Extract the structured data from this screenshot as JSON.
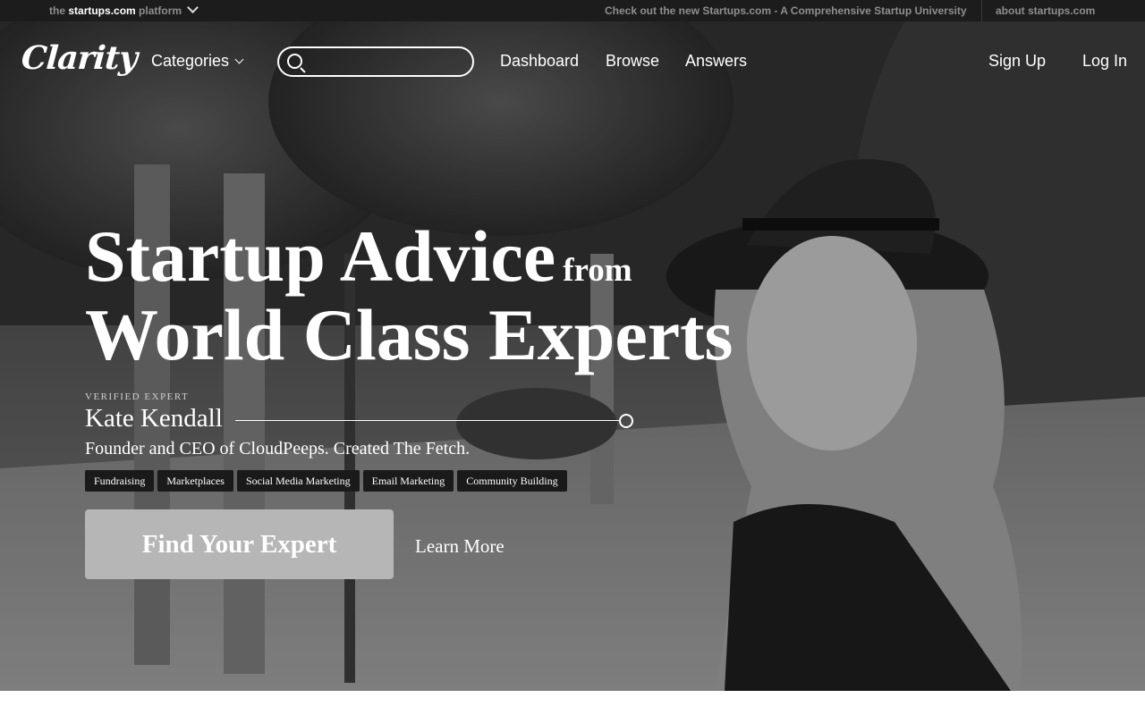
{
  "platform_bar": {
    "prefix": "the ",
    "brand": "startups.com",
    "suffix": " platform",
    "promo": "Check out the new Startups.com - A Comprehensive Startup University",
    "about": "about startups.com"
  },
  "nav": {
    "logo": "Clarity",
    "categories": "Categories",
    "search_placeholder": "",
    "links": [
      "Dashboard",
      "Browse",
      "Answers"
    ],
    "signup": "Sign Up",
    "login": "Log In"
  },
  "hero": {
    "headline_main": "Startup Advice",
    "headline_small": "from",
    "headline_line2": "World Class Experts",
    "verified_label": "VERIFIED EXPERT",
    "expert_name": "Kate Kendall",
    "expert_title": "Founder and CEO of CloudPeeps. Created The Fetch.",
    "tags": [
      "Fundraising",
      "Marketplaces",
      "Social Media Marketing",
      "Email Marketing",
      "Community Building"
    ],
    "cta": "Find Your Expert",
    "learn_more": "Learn More"
  },
  "colors": {
    "top_bar": "#1c1c1c",
    "cta_bg": "#b6b6b6",
    "tag_bg": "#1a1a1a"
  },
  "icons": [
    "search-icon",
    "chevron-down-icon",
    "circle-marker-icon"
  ]
}
